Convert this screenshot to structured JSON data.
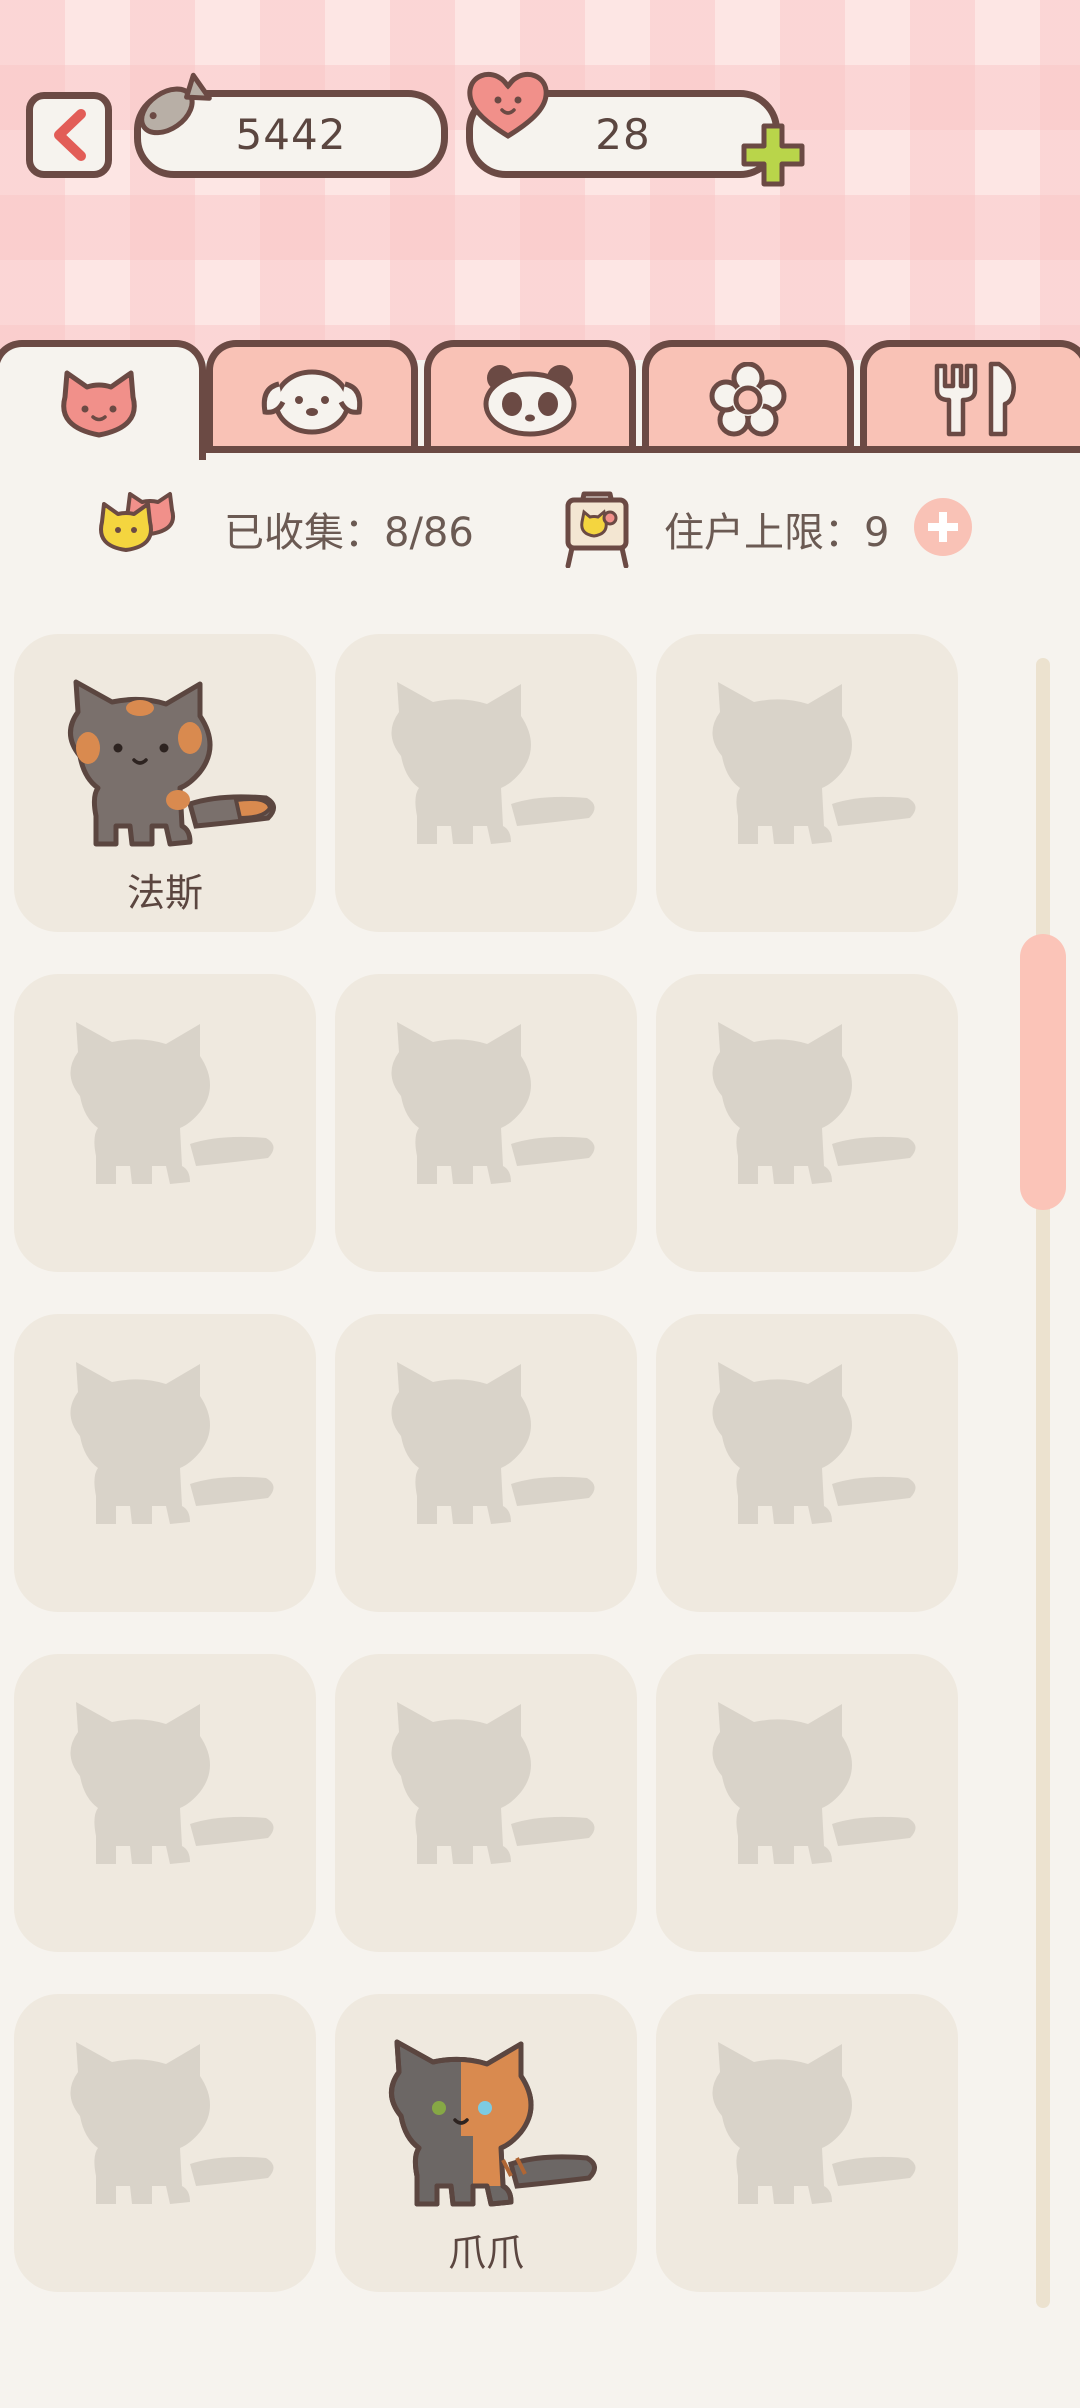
{
  "header": {
    "fish_count": "5442",
    "heart_count": "28"
  },
  "tabs": [
    {
      "name": "cats",
      "icon": "cat-face-icon",
      "active": true
    },
    {
      "name": "dogs",
      "icon": "dog-face-icon",
      "active": false
    },
    {
      "name": "pandas",
      "icon": "panda-face-icon",
      "active": false
    },
    {
      "name": "flowers",
      "icon": "flower-icon",
      "active": false
    },
    {
      "name": "food",
      "icon": "fork-spoon-icon",
      "active": false
    }
  ],
  "info": {
    "collected_label": "已收集：8/86",
    "limit_label": "住户上限：9"
  },
  "grid": {
    "cards": [
      {
        "name": "法斯",
        "unlocked": true
      },
      {
        "name": "",
        "unlocked": false
      },
      {
        "name": "",
        "unlocked": false
      },
      {
        "name": "",
        "unlocked": false
      },
      {
        "name": "",
        "unlocked": false
      },
      {
        "name": "",
        "unlocked": false
      },
      {
        "name": "",
        "unlocked": false
      },
      {
        "name": "",
        "unlocked": false
      },
      {
        "name": "",
        "unlocked": false
      },
      {
        "name": "",
        "unlocked": false
      },
      {
        "name": "",
        "unlocked": false
      },
      {
        "name": "",
        "unlocked": false
      },
      {
        "name": "",
        "unlocked": false
      },
      {
        "name": "爪爪",
        "unlocked": true
      },
      {
        "name": "",
        "unlocked": false
      }
    ]
  },
  "colors": {
    "outline": "#6b4a44",
    "accent_pink": "#f9c2b6",
    "card_bg": "#efe9df",
    "silhouette": "#d9d3c9",
    "background": "#f6f3ee"
  }
}
